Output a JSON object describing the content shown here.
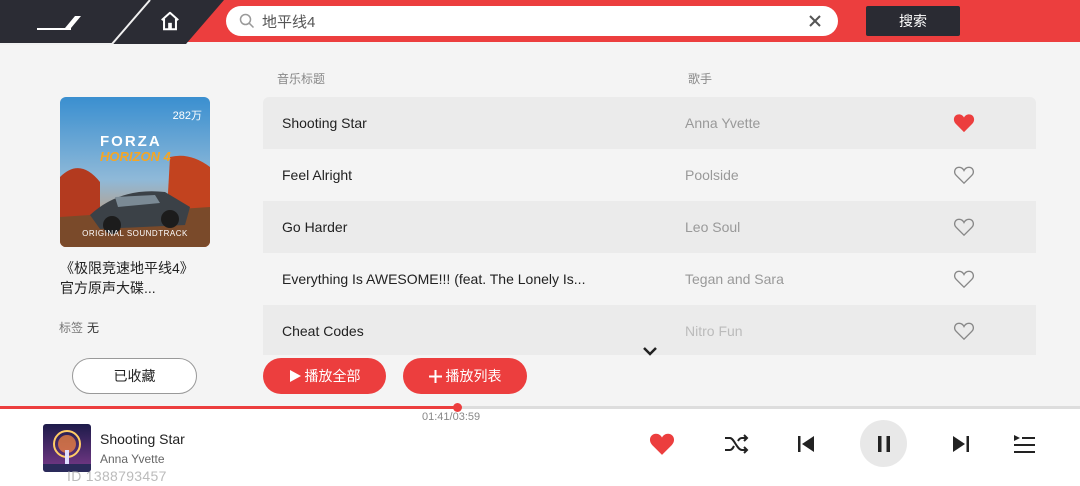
{
  "header": {
    "search": {
      "value": "地平线4"
    },
    "search_button": "搜索"
  },
  "album": {
    "play_count": "282万",
    "cover_text_brand": "FORZA",
    "cover_text_sub": "HORIZON 4",
    "cover_text_footer": "ORIGINAL SOUNDTRACK",
    "title_line1": "《极限竞速地平线4》",
    "title_line2": "官方原声大碟...",
    "tags_label": "标签",
    "tags_value": "无",
    "collected_label": "已收藏"
  },
  "table": {
    "col_title": "音乐标题",
    "col_artist": "歌手",
    "rows": [
      {
        "title": "Shooting Star",
        "artist": "Anna Yvette",
        "liked": true
      },
      {
        "title": "Feel Alright",
        "artist": "Poolside",
        "liked": false
      },
      {
        "title": "Go Harder",
        "artist": "Leo Soul",
        "liked": false
      },
      {
        "title": "Everything Is AWESOME!!! (feat. The Lonely Is...",
        "artist": "Tegan and Sara",
        "liked": false
      },
      {
        "title": "Cheat Codes",
        "artist": "Nitro Fun",
        "liked": false
      }
    ]
  },
  "actions": {
    "play_all": "播放全部",
    "play_list": "播放列表"
  },
  "player": {
    "title": "Shooting Star",
    "artist": "Anna Yvette",
    "time": "01:41/03:59",
    "progress": 0.423,
    "liked": true,
    "watermark": "ID 1388793457"
  },
  "colors": {
    "accent": "#ec3e3e",
    "dark_button": "#2a2b33"
  }
}
